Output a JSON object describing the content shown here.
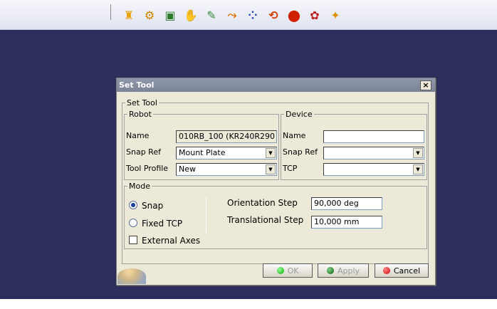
{
  "toolbar": {
    "icons": [
      {
        "name": "robot-teach-icon",
        "glyph": "♜",
        "color": "#e8a000"
      },
      {
        "name": "robot-jog-icon",
        "glyph": "⚙",
        "color": "#d08000"
      },
      {
        "name": "robot-dressup-icon",
        "glyph": "▣",
        "color": "#2a7a2a"
      },
      {
        "name": "robot-reach-icon",
        "glyph": "✋",
        "color": "#c06000"
      },
      {
        "name": "robot-tool-icon",
        "glyph": "✎",
        "color": "#3a8a3a"
      },
      {
        "name": "robot-path-icon",
        "glyph": "⤳",
        "color": "#e07000"
      },
      {
        "name": "robot-points-icon",
        "glyph": "⁘",
        "color": "#2040b0"
      },
      {
        "name": "robot-cycle-icon",
        "glyph": "⟲",
        "color": "#d04000"
      },
      {
        "name": "robot-home-icon",
        "glyph": "⬤",
        "color": "#d02000"
      },
      {
        "name": "robot-profile-icon",
        "glyph": "✿",
        "color": "#c02020"
      },
      {
        "name": "robot-setting-icon",
        "glyph": "✦",
        "color": "#e09000"
      }
    ]
  },
  "dialog": {
    "title": "Set Tool",
    "close_label": "×",
    "set_tool_legend": "Set Tool",
    "robot": {
      "legend": "Robot",
      "name_label": "Name",
      "name_value": "010RB_100 (KR240R290",
      "snap_ref_label": "Snap Ref",
      "snap_ref_value": "Mount Plate",
      "tool_profile_label": "Tool Profile",
      "tool_profile_value": "New"
    },
    "device": {
      "legend": "Device",
      "name_label": "Name",
      "name_value": "",
      "snap_ref_label": "Snap Ref",
      "snap_ref_value": "",
      "tcp_label": "TCP",
      "tcp_value": ""
    },
    "mode": {
      "legend": "Mode",
      "snap_label": "Snap",
      "fixed_tcp_label": "Fixed TCP",
      "external_axes_label": "External Axes",
      "orientation_step_label": "Orientation Step",
      "orientation_step_value": "90,000 deg",
      "translational_step_label": "Translational Step",
      "translational_step_value": "10,000 mm"
    },
    "buttons": {
      "ok": "OK",
      "apply": "Apply",
      "cancel": "Cancel"
    }
  }
}
